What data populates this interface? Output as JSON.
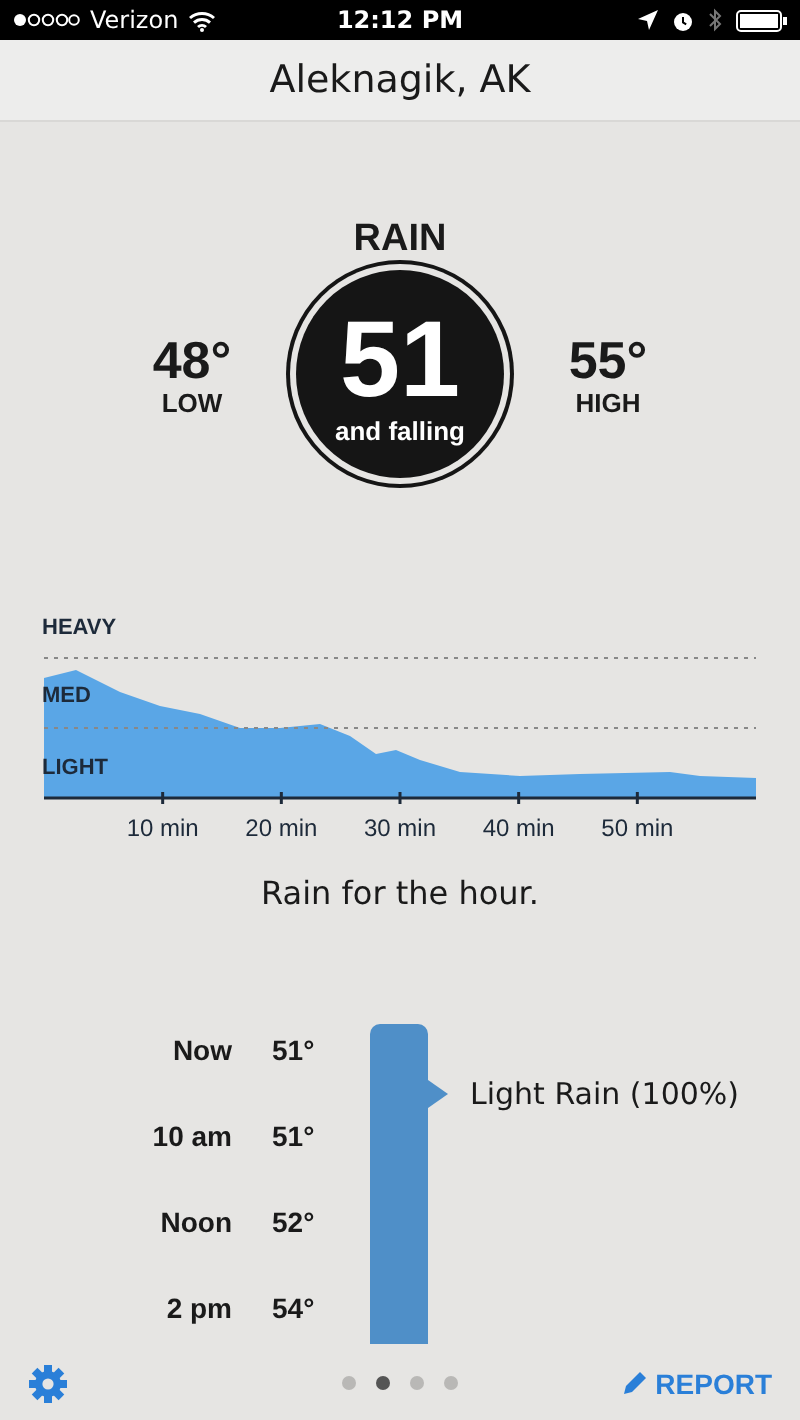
{
  "status_bar": {
    "carrier": "Verizon",
    "time": "12:12 PM"
  },
  "title": "Aleknagik, AK",
  "current": {
    "label": "RAIN",
    "temperature": "51",
    "trend": "and falling"
  },
  "low": {
    "value": "48°",
    "label": "LOW"
  },
  "high": {
    "value": "55°",
    "label": "HIGH"
  },
  "chart": {
    "levels": [
      "HEAVY",
      "MED",
      "LIGHT"
    ],
    "ticks": [
      "10 min",
      "20 min",
      "30 min",
      "40 min",
      "50 min"
    ]
  },
  "summary": "Rain for the hour.",
  "timeline": [
    {
      "time": "Now",
      "temp": "51°"
    },
    {
      "time": "10 am",
      "temp": "51°"
    },
    {
      "time": "Noon",
      "temp": "52°"
    },
    {
      "time": "2 pm",
      "temp": "54°"
    }
  ],
  "callout": "Light Rain (100%)",
  "pages": [
    {
      "selected": false
    },
    {
      "selected": true
    },
    {
      "selected": false
    },
    {
      "selected": false
    }
  ],
  "report": "REPORT"
}
